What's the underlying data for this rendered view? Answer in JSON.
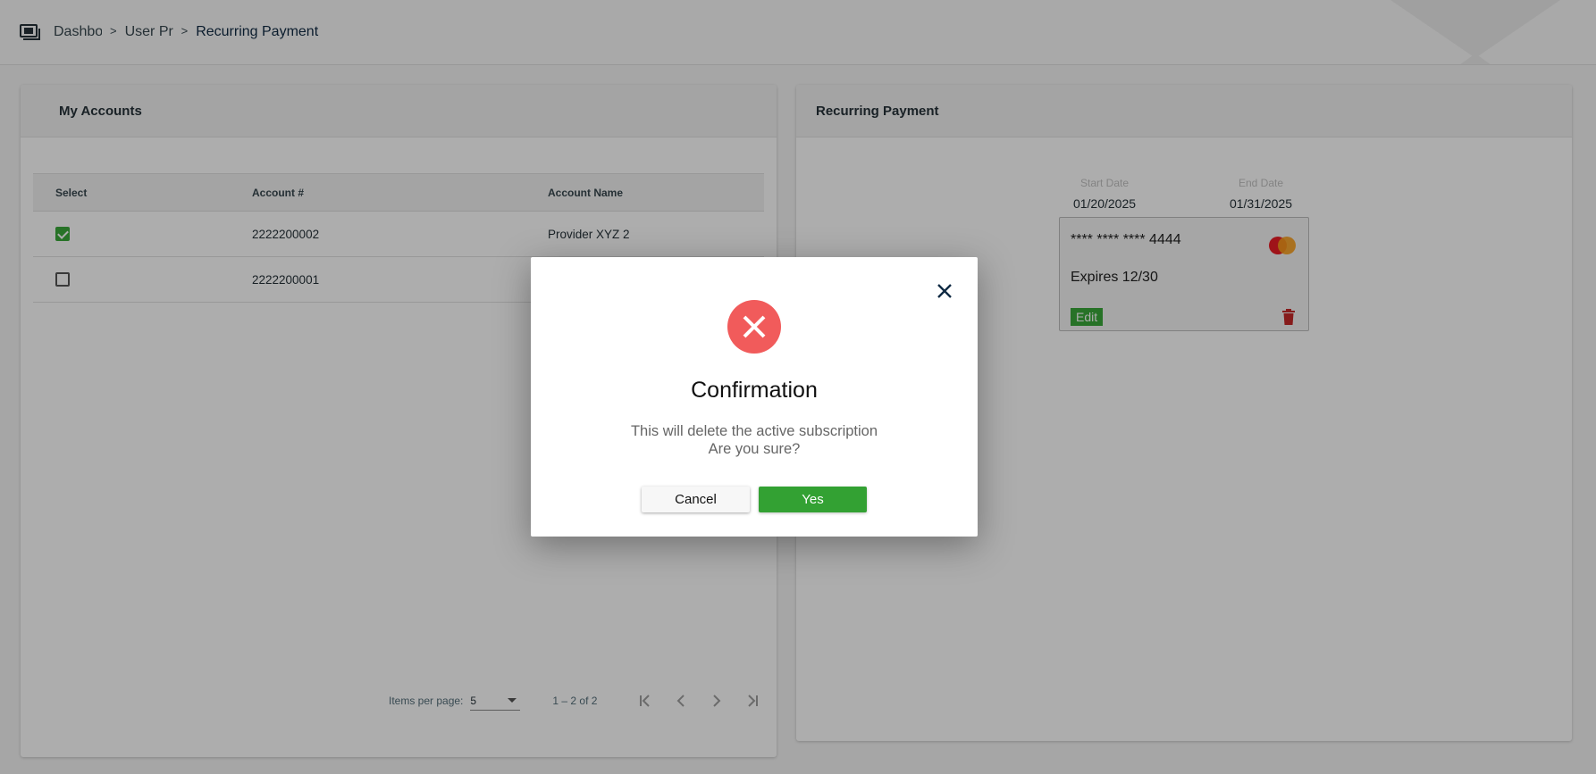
{
  "breadcrumb": {
    "items": [
      "Dashboard",
      "User Profile"
    ],
    "separator": ">",
    "current": "Recurring Payment"
  },
  "accounts": {
    "title": "My Accounts",
    "columns": [
      "Select",
      "Account #",
      "Account Name"
    ],
    "rows": [
      {
        "selected": true,
        "account": "2222200002",
        "name": "Provider XYZ 2"
      },
      {
        "selected": false,
        "account": "2222200001",
        "name": ""
      }
    ],
    "paginator": {
      "items_label": "Items per page:",
      "page_size": "5",
      "range": "1 – 2 of 2"
    }
  },
  "recurring": {
    "title": "Recurring Payment",
    "start_label": "Start Date",
    "start_value": "01/20/2025",
    "end_label": "End Date",
    "end_value": "01/31/2025",
    "card_number": "**** **** **** 4444",
    "expires": "Expires 12/30",
    "edit_label": "Edit",
    "card_brand_icon": "mastercard-icon"
  },
  "dialog": {
    "title": "Confirmation",
    "message_line1": "This will delete the active subscription",
    "message_line2": "Are you sure?",
    "cancel_label": "Cancel",
    "yes_label": "Yes",
    "colors": {
      "error": "#f15b5b",
      "confirm": "#33a133"
    }
  }
}
